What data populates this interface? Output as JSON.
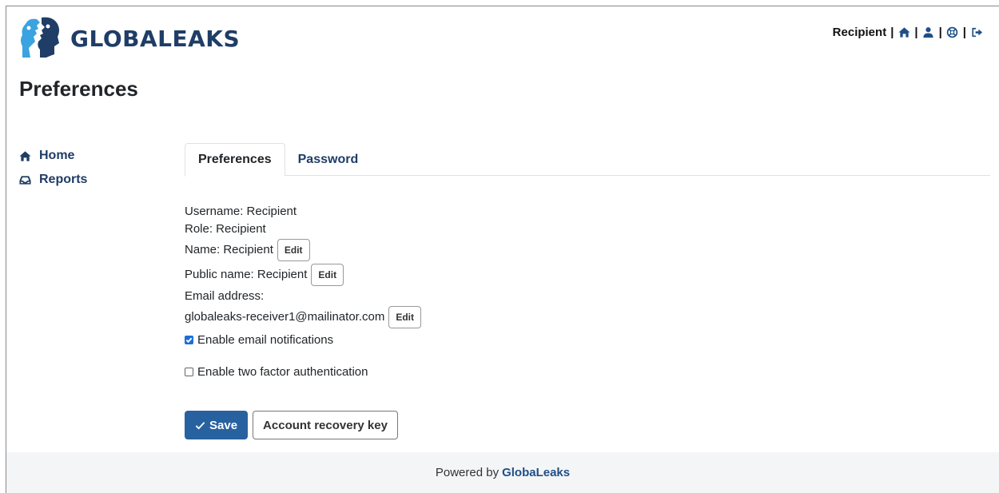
{
  "header": {
    "logo_text": "GLOBALEAKS",
    "user_label": "Recipient",
    "separator": "|",
    "nav_icons": [
      "home-icon",
      "user-icon",
      "lifebuoy-icon",
      "logout-icon"
    ],
    "accent_color": "#1f3d66"
  },
  "page": {
    "title": "Preferences"
  },
  "sidebar": {
    "items": [
      {
        "label": "Home",
        "icon": "home-icon"
      },
      {
        "label": "Reports",
        "icon": "inbox-icon"
      }
    ]
  },
  "tabs": [
    {
      "label": "Preferences",
      "active": true
    },
    {
      "label": "Password",
      "active": false
    }
  ],
  "profile": {
    "username": "Username: Recipient",
    "role": "Role: Recipient",
    "name": "Name: Recipient",
    "public_name": "Public name: Recipient",
    "email_label": "Email address:",
    "email_value": "globaleaks-receiver1@mailinator.com",
    "edit_label": "Edit"
  },
  "options": {
    "email_notifications": {
      "label": "Enable email notifications",
      "checked": true
    },
    "two_factor": {
      "label": "Enable two factor authentication",
      "checked": false
    }
  },
  "actions": {
    "save_label": "Save",
    "recovery_label": "Account recovery key"
  },
  "footer": {
    "prefix": "Powered by",
    "brand": "GlobaLeaks"
  }
}
